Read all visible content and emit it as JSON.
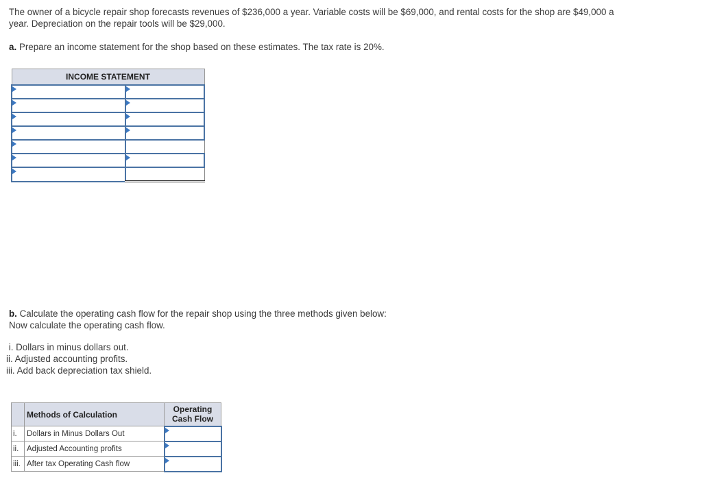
{
  "intro": "The owner of a bicycle repair shop forecasts revenues of $236,000 a year. Variable costs will be $69,000, and rental costs for the shop are $49,000 a year. Depreciation on the repair tools will be $29,000.",
  "part_a": {
    "label": "a.",
    "text": " Prepare an income statement for the shop based on these estimates. The tax rate is 20%."
  },
  "income_statement": {
    "title": "INCOME STATEMENT",
    "rows": [
      {
        "label": "",
        "value": "",
        "value_input": true
      },
      {
        "label": "",
        "value": "",
        "value_input": true
      },
      {
        "label": "",
        "value": "",
        "value_input": true
      },
      {
        "label": "",
        "value": "",
        "value_input": true
      },
      {
        "label": "",
        "value": "",
        "value_input": false
      },
      {
        "label": "",
        "value": "",
        "value_input": true
      },
      {
        "label": "",
        "value": "",
        "value_input": false
      }
    ]
  },
  "part_b": {
    "label": "b.",
    "text": " Calculate the operating cash flow for the repair shop using the three methods given below:",
    "text2": "Now calculate the operating cash flow."
  },
  "methods_list": [
    " i. Dollars in minus dollars out.",
    "ii. Adjusted accounting profits.",
    "iii. Add back depreciation tax shield."
  ],
  "ocf_table": {
    "headers": {
      "index": "",
      "method": "Methods of Calculation",
      "cash_flow_line1": "Operating",
      "cash_flow_line2": "Cash Flow"
    },
    "rows": [
      {
        "index": "i.",
        "method": "Dollars in Minus Dollars Out",
        "value": ""
      },
      {
        "index": "ii.",
        "method": "Adjusted Accounting profits",
        "value": ""
      },
      {
        "index": "iii.",
        "method": "After tax Operating Cash flow",
        "value": ""
      }
    ]
  },
  "colors": {
    "accent": "#4a73a4",
    "header_bg": "#d9dde8",
    "dropdown_marker": "#3b78c2"
  }
}
